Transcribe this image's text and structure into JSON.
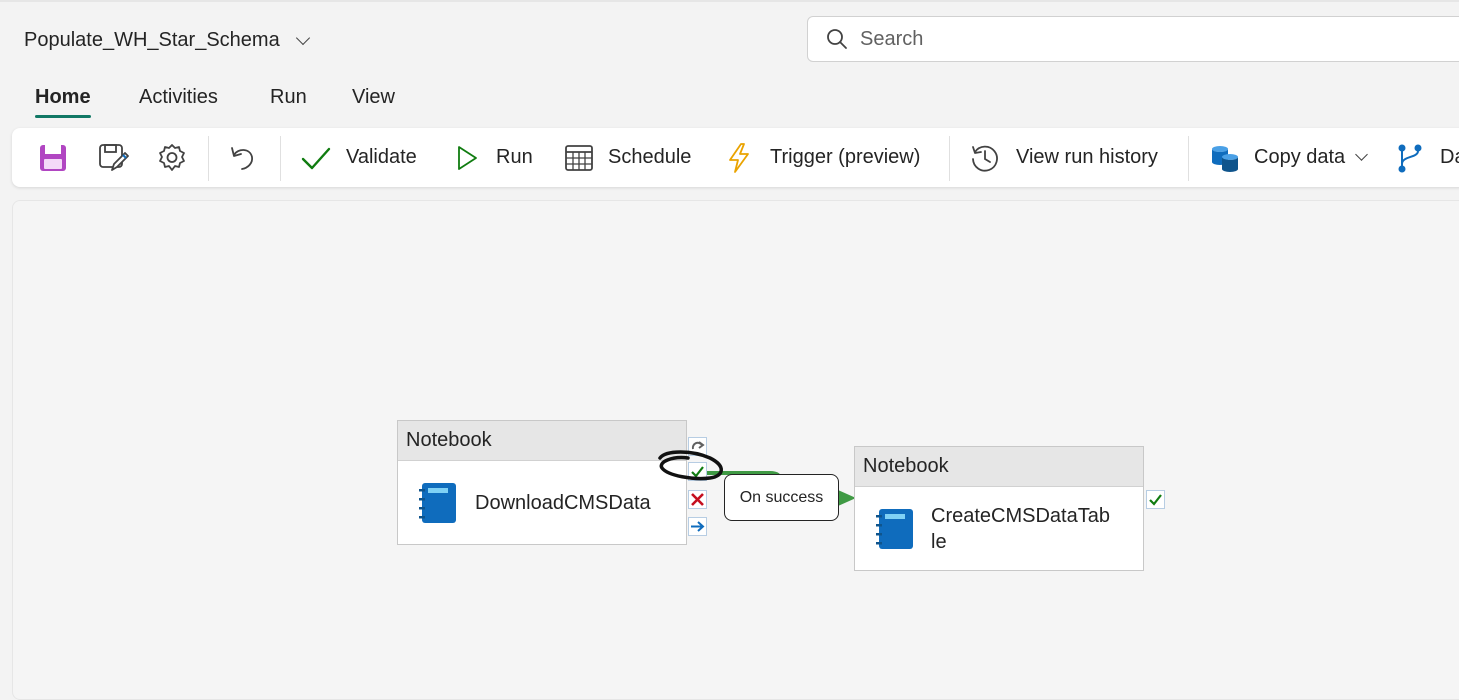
{
  "header": {
    "pipeline_name": "Populate_WH_Star_Schema",
    "search_placeholder": "Search"
  },
  "tabs": [
    {
      "label": "Home",
      "active": true
    },
    {
      "label": "Activities",
      "active": false
    },
    {
      "label": "Run",
      "active": false
    },
    {
      "label": "View",
      "active": false
    }
  ],
  "toolbar": {
    "save_icon": "save-icon",
    "save_as_icon": "save-as-icon",
    "settings_icon": "gear-icon",
    "undo_icon": "undo-icon",
    "validate": "Validate",
    "run": "Run",
    "schedule": "Schedule",
    "trigger": "Trigger (preview)",
    "view_run_history": "View run history",
    "copy_data": "Copy data",
    "dataflow_partial": "Da"
  },
  "canvas": {
    "nodes": [
      {
        "type": "Notebook",
        "name": "DownloadCMSData"
      },
      {
        "type": "Notebook",
        "name": "CreateCMSDataTab\nle"
      }
    ],
    "connection_tooltip": "On success"
  },
  "colors": {
    "accent": "#117865",
    "success": "#107c10",
    "failure": "#c50f1f",
    "notebook_blue": "#0f6cbd",
    "trigger": "#eaa300",
    "save_purple": "#b146c2"
  }
}
